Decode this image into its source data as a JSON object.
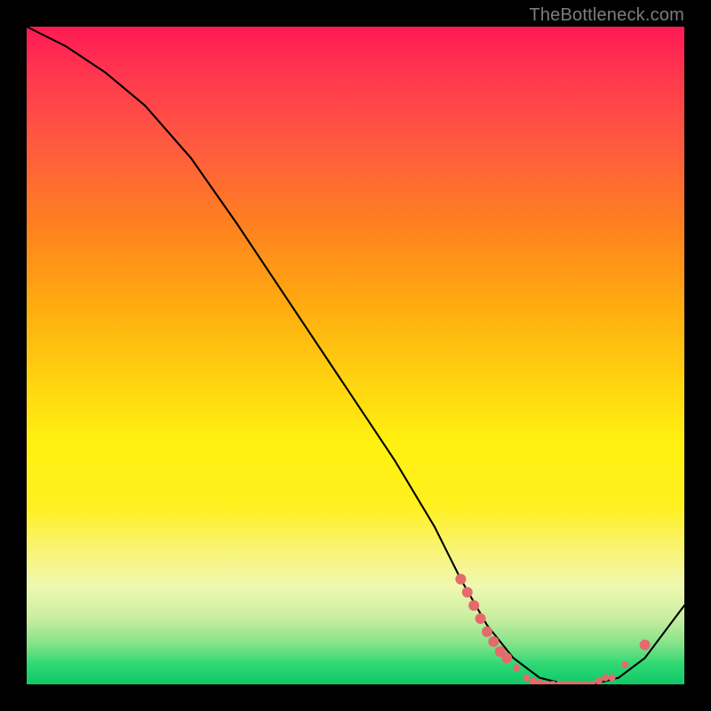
{
  "attribution": "TheBottleneck.com",
  "chart_data": {
    "type": "line",
    "title": "",
    "xlabel": "",
    "ylabel": "",
    "xlim": [
      0,
      100
    ],
    "ylim": [
      0,
      100
    ],
    "grid": false,
    "legend": false,
    "series": [
      {
        "name": "curve",
        "x": [
          0,
          6,
          12,
          18,
          25,
          32,
          40,
          48,
          56,
          62,
          66,
          70,
          74,
          78,
          82,
          86,
          90,
          94,
          100
        ],
        "y": [
          100,
          97,
          93,
          88,
          80,
          70,
          58,
          46,
          34,
          24,
          16,
          9,
          4,
          1,
          0,
          0,
          1,
          4,
          12
        ]
      }
    ],
    "markers": [
      {
        "x": 66,
        "y": 16
      },
      {
        "x": 67,
        "y": 14
      },
      {
        "x": 68,
        "y": 12
      },
      {
        "x": 69,
        "y": 10
      },
      {
        "x": 70,
        "y": 8
      },
      {
        "x": 71,
        "y": 6.5
      },
      {
        "x": 72,
        "y": 5
      },
      {
        "x": 73,
        "y": 4
      },
      {
        "x": 74.5,
        "y": 2.5
      },
      {
        "x": 76,
        "y": 1
      },
      {
        "x": 77,
        "y": 0.5
      },
      {
        "x": 78,
        "y": 0.2
      },
      {
        "x": 79,
        "y": 0
      },
      {
        "x": 80,
        "y": 0
      },
      {
        "x": 81,
        "y": 0
      },
      {
        "x": 82,
        "y": 0
      },
      {
        "x": 83,
        "y": 0
      },
      {
        "x": 84,
        "y": 0
      },
      {
        "x": 85,
        "y": 0
      },
      {
        "x": 86,
        "y": 0
      },
      {
        "x": 87,
        "y": 0.5
      },
      {
        "x": 88,
        "y": 1
      },
      {
        "x": 89,
        "y": 1
      },
      {
        "x": 91,
        "y": 3
      },
      {
        "x": 94,
        "y": 6
      }
    ],
    "marker_radii": {
      "big": 6.0,
      "small": 4.0
    },
    "colors": {
      "curve": "#000000",
      "marker": "#e46a6e"
    }
  }
}
